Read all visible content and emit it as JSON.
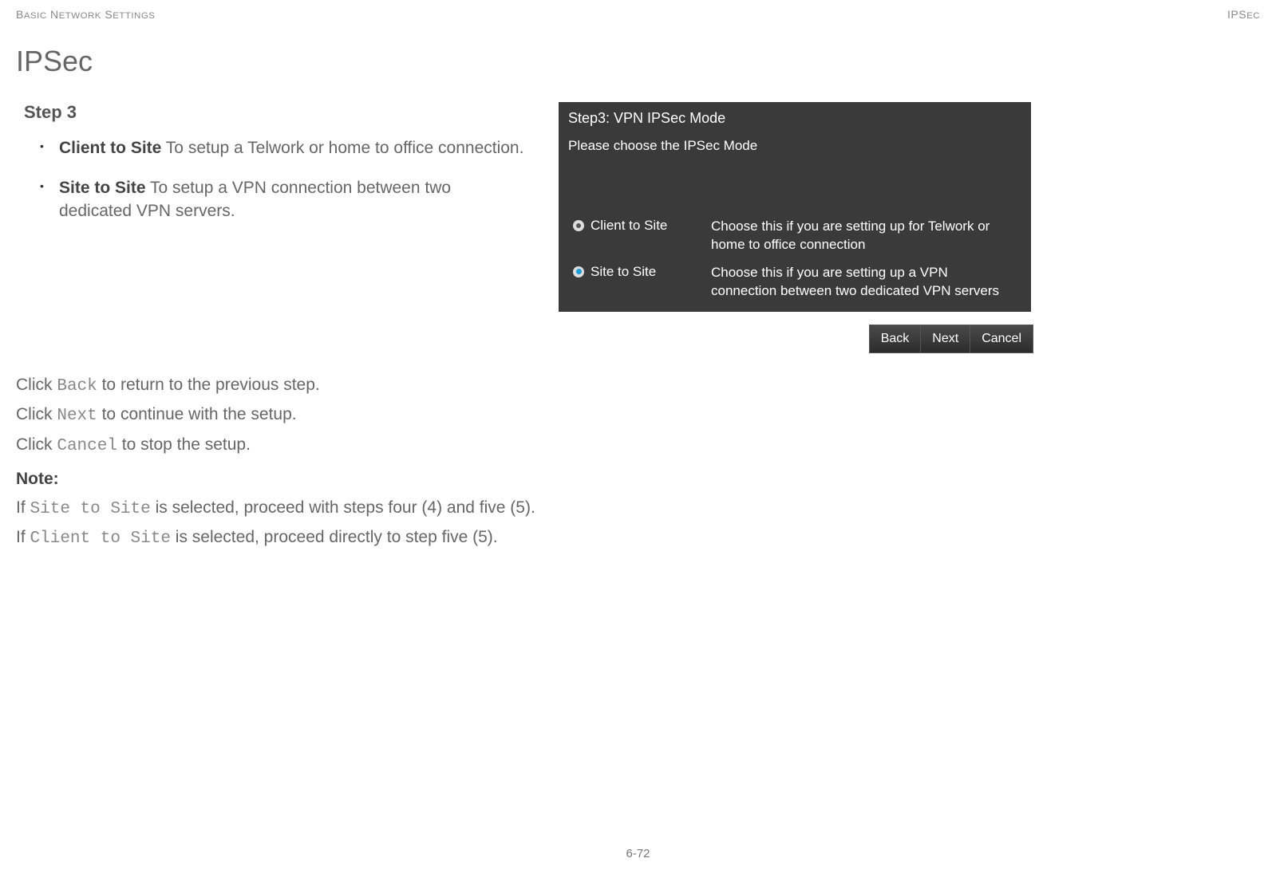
{
  "header": {
    "left_main": "B",
    "left_rest_1": "ASIC",
    "left_main_2": " N",
    "left_rest_2": "ETWORK",
    "left_main_3": " S",
    "left_rest_3": "ETTINGS",
    "right_1": "IPS",
    "right_2": "EC"
  },
  "section_title": "IPSec",
  "step_heading": "Step 3",
  "bullets": [
    {
      "bold": "Client to Site",
      "text": "  To setup a Telwork or home to office connection."
    },
    {
      "bold": "Site to Site",
      "text": "  To setup a VPN connection between two dedicated VPN servers."
    }
  ],
  "panel": {
    "title": "Step3: VPN IPSec Mode",
    "subtitle": "Please choose the IPSec Mode",
    "options": [
      {
        "label": "Client to Site",
        "desc": "Choose this if you are setting up for Telwork or home to office connection",
        "selected": false
      },
      {
        "label": "Site to Site",
        "desc": "Choose this if you are setting up a VPN connection between two dedicated VPN servers",
        "selected": true
      }
    ],
    "buttons": [
      "Back",
      "Next",
      "Cancel"
    ]
  },
  "instructions": {
    "back_pre": "Click ",
    "back_mono": "Back",
    "back_post": " to return to the previous step.",
    "next_pre": "Click ",
    "next_mono": "Next",
    "next_post": " to continue with the setup.",
    "cancel_pre": "Click ",
    "cancel_mono": "Cancel",
    "cancel_post": " to stop the setup.",
    "note_heading": "Note:",
    "note1_pre": "If ",
    "note1_mono": "Site to Site",
    "note1_post": " is selected, proceed with steps four (4) and five (5).",
    "note2_pre": "If ",
    "note2_mono": "Client to Site",
    "note2_post": " is selected, proceed directly to step five (5)."
  },
  "page_number": "6-72"
}
